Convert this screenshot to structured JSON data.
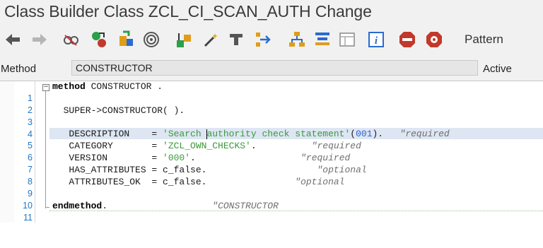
{
  "window": {
    "title": "Class Builder Class ZCL_CI_SCAN_AUTH Change"
  },
  "toolbar": {
    "icons": [
      "back-arrow-icon",
      "forward-arrow-icon",
      "other-object-icon",
      "display-change-icon",
      "activate-icon",
      "where-used-icon",
      "check-icon",
      "wizard-icon",
      "test-icon",
      "navigate-icon",
      "hierarchy-icon",
      "text-elements-icon",
      "template-icon",
      "info-icon",
      "stop-icon",
      "debug-icon"
    ],
    "pattern_label": "Pattern"
  },
  "method_bar": {
    "label": "Method",
    "value": "CONSTRUCTOR",
    "status": "Active"
  },
  "editor": {
    "lines": [
      {
        "n": "1",
        "kw": "method",
        "rest": " CONSTRUCTOR ."
      },
      {
        "n": "2",
        "text": ""
      },
      {
        "n": "3",
        "text": "  SUPER->CONSTRUCTOR( )."
      },
      {
        "n": "4",
        "text": ""
      },
      {
        "n": "5",
        "name": "   DESCRIPTION    = ",
        "str": "'Search authority check statement'",
        "open": "(",
        "num": "001",
        "close": ").",
        "pad": "   ",
        "cmt": "\"required"
      },
      {
        "n": "6",
        "name": "   CATEGORY       = ",
        "str": "'ZCL_OWN_CHECKS'",
        "close": ".",
        "pad": "          ",
        "cmt": "\"required"
      },
      {
        "n": "7",
        "name": "   VERSION        = ",
        "str": "'000'",
        "close": ".",
        "pad": "                   ",
        "cmt": "\"required"
      },
      {
        "n": "8",
        "name": "   HAS_ATTRIBUTES = c_false.",
        "pad": "                    ",
        "cmt": "\"optional"
      },
      {
        "n": "9",
        "name": "   ATTRIBUTES_OK  = c_false.",
        "pad": "                ",
        "cmt": "\"optional"
      },
      {
        "n": "10",
        "text": ""
      },
      {
        "n": "11",
        "kw": "endmethod",
        "rest": ".",
        "pad": "                   ",
        "cmt": "\"CONSTRUCTOR"
      }
    ]
  },
  "colors": {
    "accent": "#1e77c8",
    "string": "#3a9a3a",
    "comment": "#6f6f6f",
    "highlight": "#dde6f2"
  }
}
